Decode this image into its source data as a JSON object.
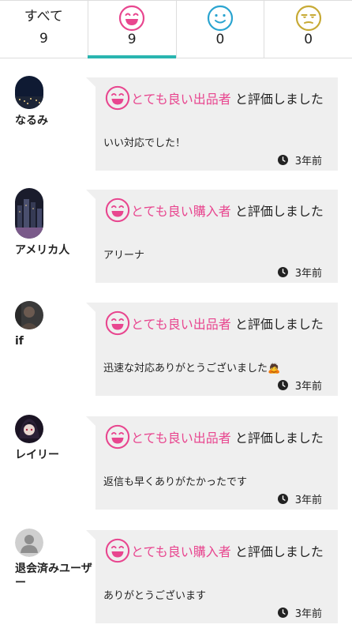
{
  "tabs": [
    {
      "label": "すべて",
      "count": "9",
      "icon": null,
      "active": false
    },
    {
      "label": "",
      "count": "9",
      "icon": "smile-face-icon",
      "color": "#e8468f",
      "active": true
    },
    {
      "label": "",
      "count": "0",
      "icon": "neutral-face-icon",
      "color": "#2aa4d0",
      "active": false
    },
    {
      "label": "",
      "count": "0",
      "icon": "unamused-face-icon",
      "color": "#c7aa35",
      "active": false
    }
  ],
  "colors": {
    "accent": "#29b5b0",
    "good": "#e8468f",
    "bubble": "#efefef"
  },
  "reviews": [
    {
      "user": "なるみ",
      "rating": "とても良い出品者",
      "action": " と評価しました",
      "comment": "いい対応でした！",
      "time": "3年前"
    },
    {
      "user": "アメリカ人",
      "rating": "とても良い購入者",
      "action": " と評価しました",
      "comment": "アリーナ",
      "time": "3年前"
    },
    {
      "user": "if",
      "rating": "とても良い出品者",
      "action": " と評価しました",
      "comment": "迅速な対応ありがとうございました🙇",
      "time": "3年前"
    },
    {
      "user": "レイリー",
      "rating": "とても良い出品者",
      "action": " と評価しました",
      "comment": "返信も早くありがたかったです",
      "time": "3年前"
    },
    {
      "user": "退会済みユーザー",
      "rating": "とても良い購入者",
      "action": " と評価しました",
      "comment": "ありがとうございます",
      "time": "3年前"
    }
  ]
}
